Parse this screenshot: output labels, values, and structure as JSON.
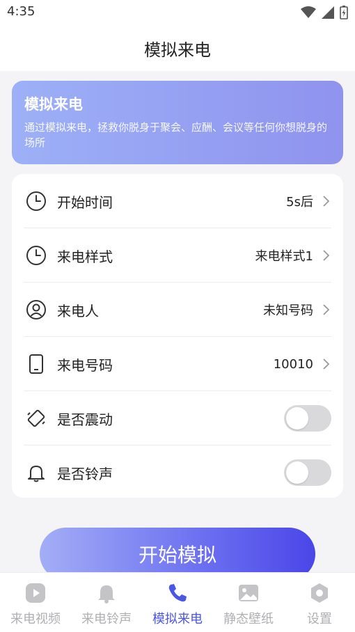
{
  "status": {
    "time": "4:35",
    "icons": [
      "wifi-icon",
      "signal-icon",
      "battery-icon"
    ]
  },
  "header": {
    "title": "模拟来电"
  },
  "banner": {
    "title": "模拟来电",
    "description": "通过模拟来电，拯救你脱身于聚会、应酬、会议等任何你想脱身的场所"
  },
  "settings": {
    "items": [
      {
        "label": "开始时间",
        "value": "5s后",
        "icon": "clock-icon"
      },
      {
        "label": "来电样式",
        "value": "来电样式1",
        "icon": "clock-icon"
      },
      {
        "label": "来电人",
        "value": "未知号码",
        "icon": "user-icon"
      },
      {
        "label": "来电号码",
        "value": "10010",
        "icon": "phone-device-icon"
      },
      {
        "label": "是否震动",
        "value": "",
        "icon": "vibrate-icon",
        "toggle": false
      },
      {
        "label": "是否铃声",
        "value": "",
        "icon": "bell-icon",
        "toggle": false
      }
    ]
  },
  "start_button": {
    "label": "开始模拟"
  },
  "tabs": [
    {
      "label": "来电视频",
      "icon": "play-icon",
      "active": false
    },
    {
      "label": "来电铃声",
      "icon": "bell-icon",
      "active": false
    },
    {
      "label": "模拟来电",
      "icon": "phone-icon",
      "active": true
    },
    {
      "label": "静态壁纸",
      "icon": "image-icon",
      "active": false
    },
    {
      "label": "设置",
      "icon": "gear-icon",
      "active": false
    }
  ],
  "colors": {
    "accent": "#4b55e6",
    "inactive": "#b0b0b3"
  }
}
